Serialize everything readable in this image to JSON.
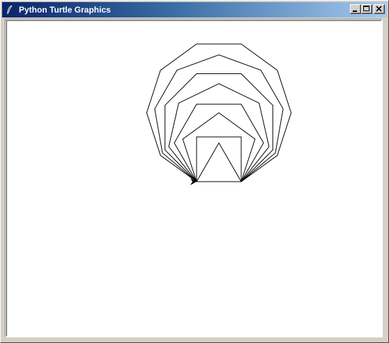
{
  "window": {
    "title": "Python Turtle Graphics",
    "buttons": {
      "minimize_icon": "minimize-icon",
      "maximize_icon": "maximize-icon",
      "close_icon": "close-icon"
    }
  },
  "drawing": {
    "stroke_color": "#000000",
    "background_color": "#ffffff",
    "cursor_icon": "turtle-arrow-icon"
  }
}
